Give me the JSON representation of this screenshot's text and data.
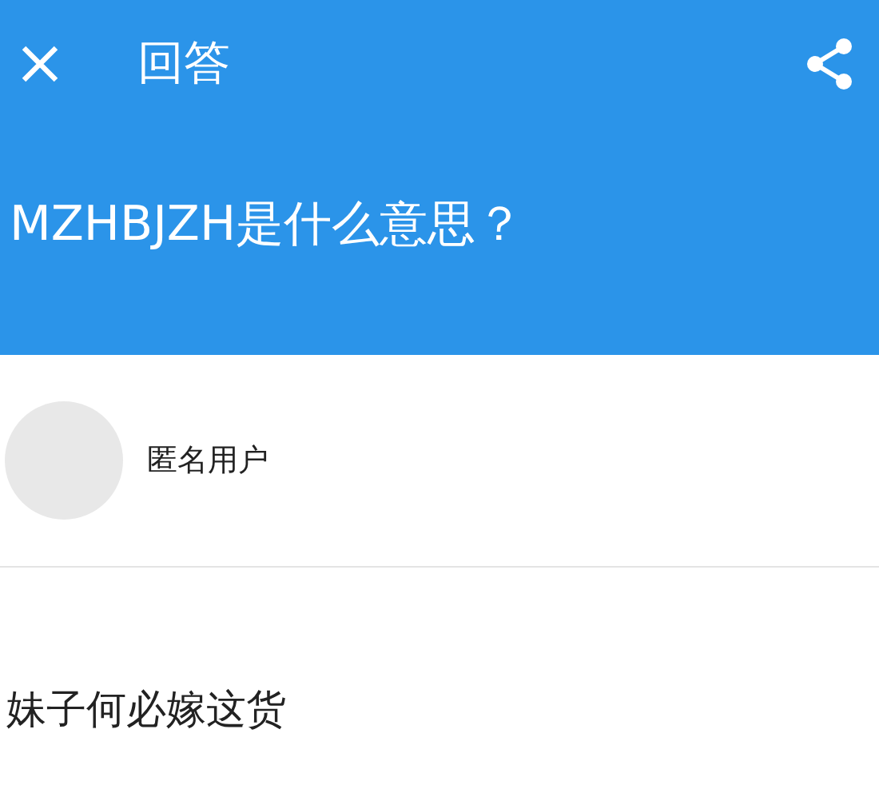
{
  "top_bar": {
    "title": "回答"
  },
  "question": {
    "title": "MZHBJZH是什么意思？"
  },
  "answer": {
    "author": "匿名用户",
    "text": "妹子何必嫁这货"
  }
}
